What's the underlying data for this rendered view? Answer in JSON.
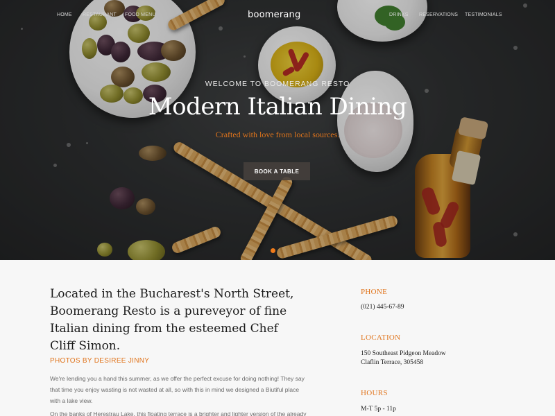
{
  "nav": {
    "left": [
      "HOME",
      "RESTAURANT",
      "FOOD MENU"
    ],
    "brand": "boomerang",
    "right": [
      "DRINKS",
      "RESERVATIONS",
      "TESTIMONIALS"
    ]
  },
  "hero": {
    "kicker": "WELCOME TO BOOMERANG RESTO",
    "title": "Modern Italian Dining",
    "subtitle": "Crafted with love from local sources.",
    "button": "BOOK A TABLE",
    "accent": "#f07b1a"
  },
  "about": {
    "intro": "Located in the Bucharest's North Street, Boomerang Resto is a pureveyor of fine Italian dining from the esteemed Chef Cliff Simon.",
    "credit": "PHOTOS BY DESIREE JINNY",
    "paragraphs": [
      "We're lending you a hand this summer, as we offer the perfect excuse for doing nothing! They say that time you enjoy wasting is not wasted at all, so with this in mind we designed a Biutiful place with a lake view.",
      "On the banks of Herestrau Lake, this floating terrace is a brighter and lighter version of the already"
    ]
  },
  "info": {
    "phone_label": "PHONE",
    "phone": "(021) 445-67-89",
    "location_label": "LOCATION",
    "location_line1": "150 Southeast Pidgeon Meadow",
    "location_line2": "Claflin Terrace, 305458",
    "hours_label": "HOURS",
    "hours": "M-T 5p - 11p"
  }
}
